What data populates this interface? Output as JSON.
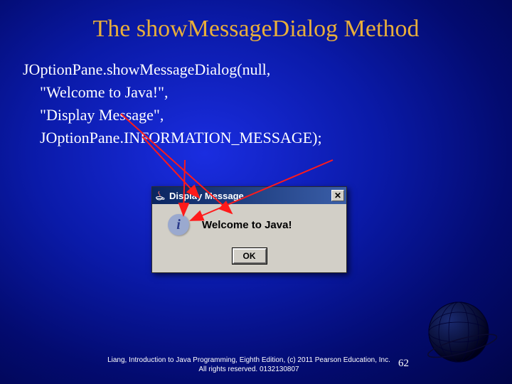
{
  "title": "The showMessageDialog Method",
  "code": {
    "line1": "JOptionPane.showMessageDialog(null,",
    "line2": "\"Welcome to Java!\",",
    "line3": "\"Display Message\",",
    "line4": "JOptionPane.INFORMATION_MESSAGE);"
  },
  "dialog": {
    "title": "Display Message",
    "message": "Welcome to Java!",
    "ok_label": "OK",
    "close_label": "✕",
    "info_i": "i"
  },
  "footer": "Liang, Introduction to Java Programming, Eighth Edition, (c) 2011 Pearson Education, Inc. All rights reserved. 0132130807",
  "page_number": "62"
}
